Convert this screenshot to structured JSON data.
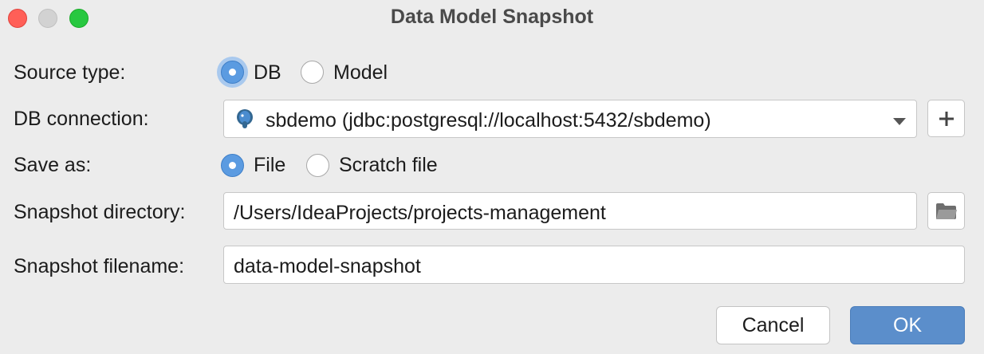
{
  "window": {
    "title": "Data Model Snapshot"
  },
  "form": {
    "source_type": {
      "label": "Source type:",
      "options": [
        "DB",
        "Model"
      ],
      "selected": "DB"
    },
    "db_connection": {
      "label": "DB connection:",
      "value": "sbdemo (jdbc:postgresql://localhost:5432/sbdemo)",
      "icon": "postgresql-elephant-icon"
    },
    "save_as": {
      "label": "Save as:",
      "options": [
        "File",
        "Scratch file"
      ],
      "selected": "File"
    },
    "snapshot_directory": {
      "label": "Snapshot directory:",
      "value": "/Users/IdeaProjects/projects-management"
    },
    "snapshot_filename": {
      "label": "Snapshot filename:",
      "value": "data-model-snapshot"
    }
  },
  "buttons": {
    "cancel": "Cancel",
    "ok": "OK"
  },
  "colors": {
    "accent": "#5b9be1",
    "ok_button": "#5b8ecb",
    "close": "#ff5f57",
    "maximize": "#28c840"
  }
}
